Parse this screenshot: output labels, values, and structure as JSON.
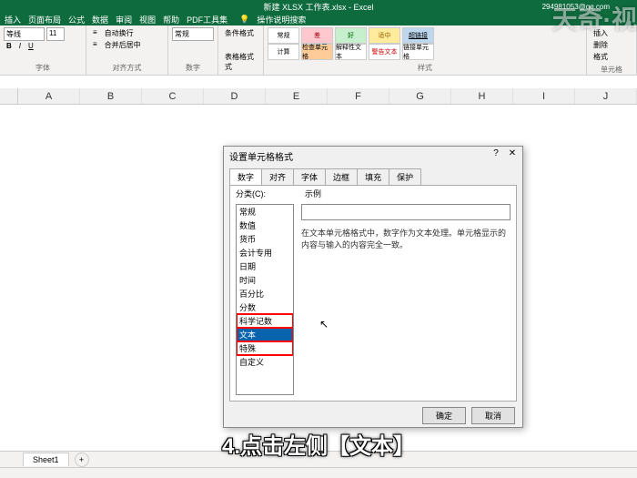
{
  "title": "新建 XLSX 工作表.xlsx - Excel",
  "user": "294981053@qq.com",
  "tabs": [
    "插入",
    "页面布局",
    "公式",
    "数据",
    "审阅",
    "视图",
    "帮助",
    "PDF工具集"
  ],
  "tell_me": "操作说明搜索",
  "ribbon": {
    "font": {
      "label": "字体",
      "name": "等线",
      "size": "11"
    },
    "align": {
      "label": "对齐方式",
      "wrap": "自动换行",
      "merge": "合并后居中"
    },
    "number": {
      "label": "数字",
      "format": "常规"
    },
    "condfmt": {
      "label": "条件格式",
      "tablefmt": "表格格式式"
    },
    "styles": {
      "label": "样式",
      "items": [
        "常规",
        "差",
        "好",
        "适中",
        "超链接"
      ],
      "row2": [
        "计算",
        "检查单元格",
        "解释性文本",
        "警告文本",
        "链接单元格"
      ]
    },
    "cells": {
      "label": "单元格",
      "insert": "插入",
      "delete": "删除",
      "format": "格式"
    }
  },
  "columns": [
    "A",
    "B",
    "C",
    "D",
    "E",
    "F",
    "G",
    "H",
    "I",
    "J"
  ],
  "dialog": {
    "title": "设置单元格格式",
    "tabs": [
      "数字",
      "对齐",
      "字体",
      "边框",
      "填充",
      "保护"
    ],
    "active_tab": 0,
    "cat_label": "分类(C):",
    "sample_label": "示例",
    "categories": [
      "常规",
      "数值",
      "货币",
      "会计专用",
      "日期",
      "时间",
      "百分比",
      "分数",
      "科学记数",
      "文本",
      "特殊",
      "自定义"
    ],
    "selected_index": 9,
    "highlight_start": 8,
    "highlight_end": 10,
    "description": "在文本单元格格式中，数字作为文本处理。单元格显示的内容与输入的内容完全一致。",
    "ok": "确定",
    "cancel": "取消"
  },
  "sheet": {
    "name": "Sheet1"
  },
  "caption": "4.点击左侧【文本】",
  "watermark": "天奇·视"
}
